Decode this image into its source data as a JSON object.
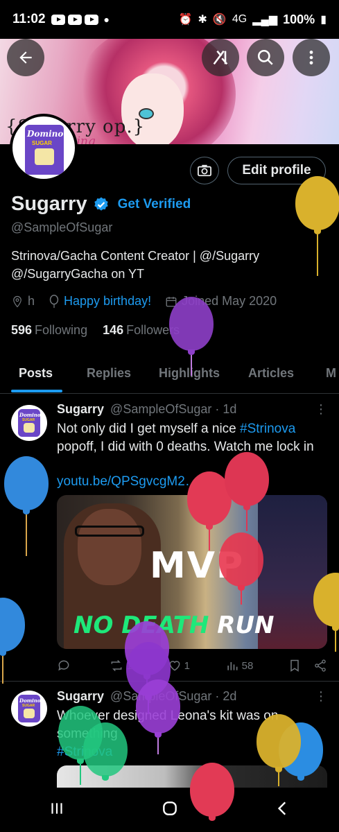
{
  "status_bar": {
    "time": "11:02",
    "network": "4G",
    "battery": "100%"
  },
  "profile": {
    "name": "Sugarry",
    "get_verified": "Get Verified",
    "handle": "@SampleOfSugar",
    "bio": "Strinova/Gacha Content Creator | @/Sugarry @/SugarryGacha on YT",
    "location": "h",
    "birthday": "Happy birthday!",
    "joined": "Joined May 2020",
    "following_count": "596",
    "following_label": "Following",
    "followers_count": "146",
    "followers_label": "Followers",
    "edit_profile": "Edit profile"
  },
  "banner": {
    "logo_text": "{Sugarry op.}",
    "logo_sub": "Dating"
  },
  "avatar": {
    "brand": "Domino",
    "label": "SUGAR"
  },
  "tabs": [
    "Posts",
    "Replies",
    "Highlights",
    "Articles",
    "M"
  ],
  "posts": [
    {
      "author": "Sugarry",
      "handle": "@SampleOfSugar",
      "time": "· 1d",
      "text_before": "Not only did I get myself a nice ",
      "hashtag": "#Strinova",
      "text_after": " popoff, I did with 0 deaths. Watch me lock in",
      "link": "youtu.be/QPSgvcgM2…",
      "media": {
        "big_text": "MVP",
        "bottom_text_a": "NO DEATH",
        "bottom_text_b": " RUN"
      },
      "stats": {
        "replies": "",
        "reposts": "1",
        "likes": "1",
        "views": "58"
      }
    },
    {
      "author": "Sugarry",
      "handle": "@SampleOfSugar",
      "time": "· 2d",
      "text": "Whoever designed Leona's kit was on something",
      "hashtag": "#Strinova"
    }
  ],
  "colors": {
    "accent": "#1d9bf0",
    "background": "#000000",
    "muted": "#71767b",
    "text": "#e7e9ea"
  },
  "icons": [
    "back-arrow-icon",
    "grok-icon",
    "search-icon",
    "more-vertical-icon",
    "camera-icon",
    "verified-badge-icon",
    "location-icon",
    "balloon-icon",
    "calendar-icon",
    "reply-icon",
    "repost-icon",
    "like-icon",
    "views-icon",
    "bookmark-icon",
    "share-icon",
    "recents-icon",
    "home-icon",
    "back-icon"
  ]
}
